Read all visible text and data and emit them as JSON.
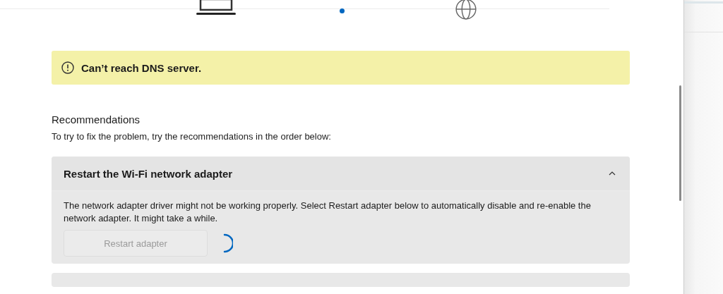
{
  "status_banner": {
    "kind": "warning",
    "message": "Can’t reach DNS server."
  },
  "recommendations": {
    "heading": "Recommendations",
    "intro": "To try to fix the problem, try the recommendations in the order below:",
    "items": [
      {
        "title": "Restart the Wi-Fi network adapter",
        "expanded": true,
        "description": "The network adapter driver might not be working properly. Select Restart adapter below to automatically disable and re-enable the network adapter. It might take a while.",
        "button": {
          "label": "Restart adapter",
          "disabled": true
        },
        "busy": true
      }
    ],
    "more_below": true
  }
}
